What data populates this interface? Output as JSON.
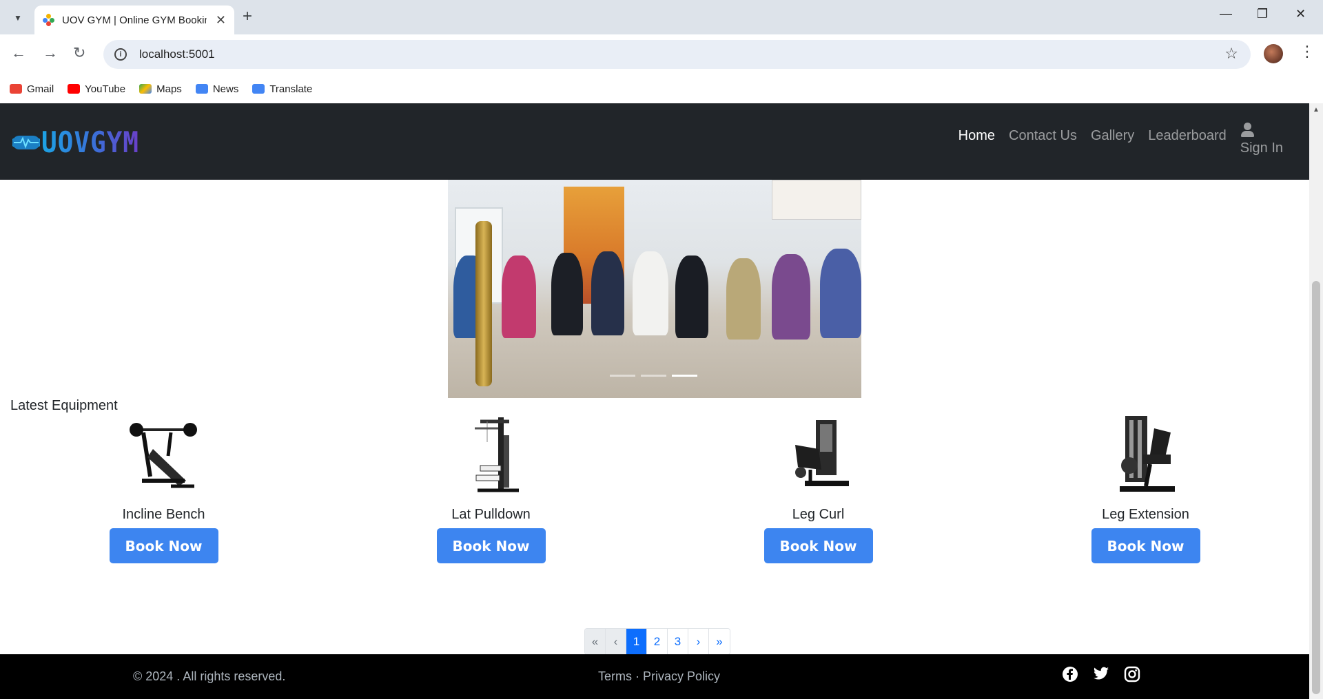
{
  "browser": {
    "tab_title": "UOV GYM | Online GYM Booking",
    "url": "localhost:5001",
    "bookmarks": [
      {
        "label": "Gmail",
        "icon": "gmail-icon",
        "color": "#ea4335"
      },
      {
        "label": "YouTube",
        "icon": "youtube-icon",
        "color": "#ff0000"
      },
      {
        "label": "Maps",
        "icon": "maps-icon",
        "color": "#34a853"
      },
      {
        "label": "News",
        "icon": "news-icon",
        "color": "#4285f4"
      },
      {
        "label": "Translate",
        "icon": "translate-icon",
        "color": "#4285f4"
      }
    ]
  },
  "navbar": {
    "logo_text": "UOVGYM",
    "links": [
      "Home",
      "Contact Us",
      "Gallery",
      "Leaderboard"
    ],
    "active_link": "Home",
    "signin_label": "Sign In"
  },
  "carousel": {
    "slide_count": 3,
    "active_slide": 3
  },
  "equipment": {
    "section_title": "Latest Equipment",
    "items": [
      {
        "name": "Incline Bench",
        "button": "Book Now",
        "icon": "incline-bench-icon"
      },
      {
        "name": "Lat Pulldown",
        "button": "Book Now",
        "icon": "lat-pulldown-icon"
      },
      {
        "name": "Leg Curl",
        "button": "Book Now",
        "icon": "leg-curl-icon"
      },
      {
        "name": "Leg Extension",
        "button": "Book Now",
        "icon": "leg-extension-icon"
      }
    ]
  },
  "pagination": {
    "first": "«",
    "prev": "‹",
    "pages": [
      "1",
      "2",
      "3"
    ],
    "active_page": "1",
    "next": "›",
    "last": "»"
  },
  "footer": {
    "copyright": "© 2024 . All rights reserved.",
    "links": "Terms · Privacy Policy",
    "social": [
      "facebook-icon",
      "twitter-icon",
      "instagram-icon"
    ]
  },
  "colors": {
    "navbar_bg": "#212529",
    "button_blue": "#3d85f0",
    "footer_bg": "#000000"
  }
}
